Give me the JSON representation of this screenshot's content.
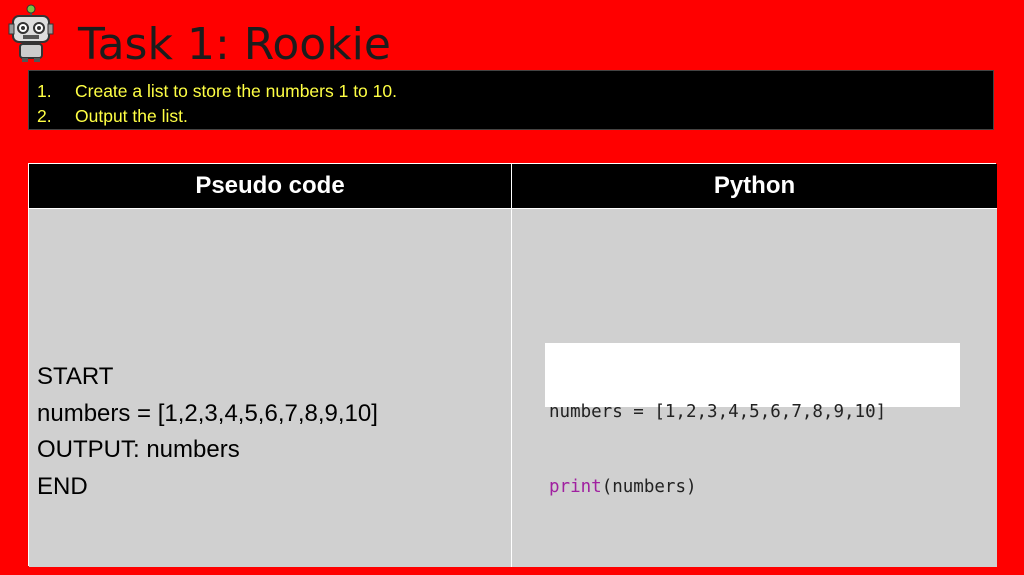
{
  "title": "Task 1: Rookie",
  "tasks": [
    {
      "num": "1.",
      "text": "Create a list to store the numbers 1 to 10."
    },
    {
      "num": "2.",
      "text": "Output the list."
    }
  ],
  "table": {
    "headers": [
      "Pseudo code",
      "Python"
    ],
    "pseudo_lines": [
      "START",
      "numbers = [1,2,3,4,5,6,7,8,9,10]",
      "OUTPUT: numbers",
      "END"
    ],
    "python_code": {
      "line1": "numbers = [1,2,3,4,5,6,7,8,9,10]",
      "line2_keyword": "print",
      "line2_rest": "(numbers)"
    }
  },
  "icons": [
    "robot-icon"
  ],
  "colors": {
    "background": "#ff0000",
    "task_text": "#ffff44",
    "keyword": "#a020a0"
  }
}
